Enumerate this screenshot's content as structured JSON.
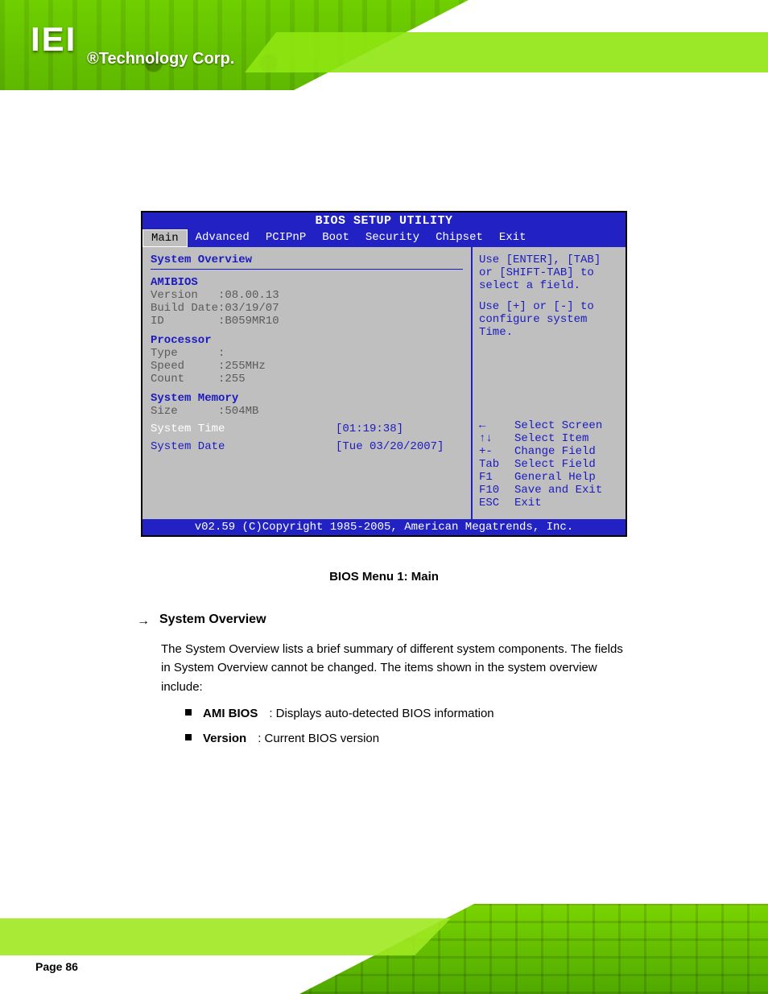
{
  "header": {
    "logo": "IEI",
    "tagline": "®Technology Corp."
  },
  "bios": {
    "title": "BIOS SETUP UTILITY",
    "tabs": [
      "Main",
      "Advanced",
      "PCIPnP",
      "Boot",
      "Security",
      "Chipset",
      "Exit"
    ],
    "active_tab": "Main",
    "left": {
      "overview": "System Overview",
      "amibios_title": "AMIBIOS",
      "amibios": [
        {
          "k": "Version",
          "v": ":08.00.13"
        },
        {
          "k": "Build Date",
          "v": ":03/19/07"
        },
        {
          "k": "ID",
          "v": ":B059MR10"
        }
      ],
      "processor_title": "Processor",
      "processor": [
        {
          "k": "Type",
          "v": ":"
        },
        {
          "k": "Speed",
          "v": ":255MHz"
        },
        {
          "k": "Count",
          "v": ":255"
        }
      ],
      "memory_title": "System Memory",
      "memory": [
        {
          "k": "Size",
          "v": ":504MB"
        }
      ],
      "systime_label": "System Time",
      "systime_value": "[01:19:38]",
      "sysdate_label": "System Date",
      "sysdate_value": "[Tue 03/20/2007]"
    },
    "right": {
      "help1": "Use [ENTER], [TAB]",
      "help2": "or [SHIFT-TAB] to",
      "help3": "select a field.",
      "help4": "Use [+] or [-] to",
      "help5": "configure system Time.",
      "nav": [
        {
          "key": "←",
          "label": "Select Screen"
        },
        {
          "key": "↑↓",
          "label": "Select Item"
        },
        {
          "key": "+-",
          "label": "Change Field"
        },
        {
          "key": "Tab",
          "label": "Select Field"
        },
        {
          "key": "F1",
          "label": "General Help"
        },
        {
          "key": "F10",
          "label": "Save and Exit"
        },
        {
          "key": "ESC",
          "label": "Exit"
        }
      ]
    },
    "footer": "v02.59 (C)Copyright 1985-2005, American Megatrends, Inc."
  },
  "caption": "BIOS Menu 1: Main",
  "section": {
    "arrow": "→",
    "label": "System Overview",
    "para": "The System Overview lists a brief summary of different system components. The fields in System Overview cannot be changed. The items shown in the system overview include:",
    "bullets": [
      {
        "label": "AMI BIOS",
        "desc": ": Displays auto-detected BIOS information",
        "sub": [
          {
            "label": "Version",
            "desc": ": Current BIOS version"
          }
        ]
      }
    ]
  },
  "page_number": "Page 86"
}
